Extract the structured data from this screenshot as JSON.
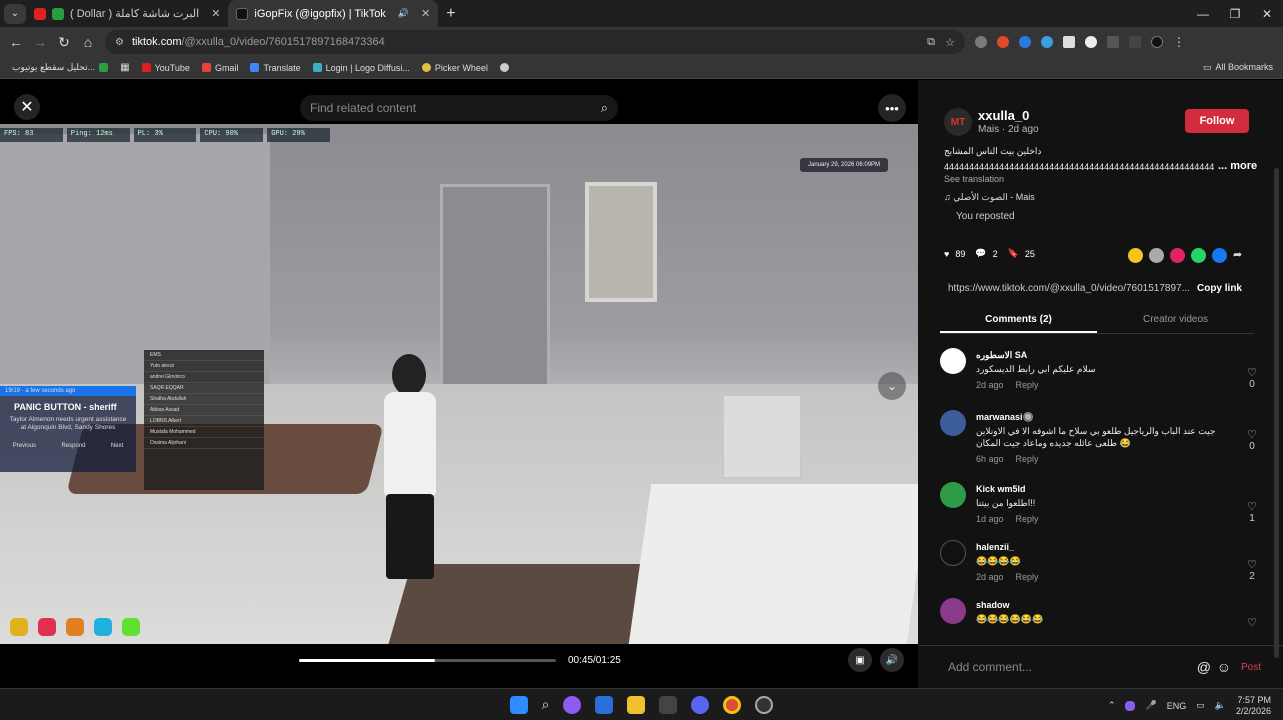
{
  "browser": {
    "tabs": [
      {
        "label": "( Dollar ) البرت شاشة كاملة",
        "active": false,
        "icon": "youtube-icon"
      },
      {
        "label": "iGopFix (@igopfix) | TikTok",
        "active": true,
        "icon": "tiktok-icon"
      }
    ],
    "url_host": "tiktok.com",
    "url_path": "/@xxulla_0/video/7601517897168473364",
    "bookmarks": [
      "تحليل سقطع يوتيوب...",
      "YouTube",
      "Gmail",
      "Translate",
      "Login | Logo Diffusi...",
      "Picker Wheel"
    ],
    "all_bookmarks": "All Bookmarks"
  },
  "video": {
    "search_placeholder": "Find related content",
    "time": "00:45/01:25",
    "progress_fraction": 0.53,
    "hud": [
      "FPS: 83",
      "Ping: 12ms",
      "PL: 3%",
      "CPU: 90%",
      "GPU: 29%"
    ],
    "timestamp": "January 29, 2026 06:09PM",
    "panic": {
      "head": "19/19 · a few seconds ago",
      "title": "PANIC BUTTON - sheriff",
      "body": "Taylor Almenon needs urgent assistance at Algonquin Blvd, Sandy Shores",
      "actions": [
        "Previous",
        "Respond",
        "Next"
      ]
    },
    "ems_rows": [
      "EMS",
      "Yuto alerut",
      "andrei Glovinco",
      "SAQR EQQAR",
      "Shatha Abdullah",
      "Abbas Assad",
      "LOBNS Albert",
      "Mustafa Mohammed",
      "Ossima Aljohani"
    ]
  },
  "creator": {
    "avatar": "MT",
    "username": "xxulla_0",
    "meta": "Mais · 2d ago",
    "follow": "Follow",
    "caption_line1": "داخلين بيت الناس المشابج",
    "caption_line2": "4444444444444444444444444444444444444444444444444444444444",
    "more": "... more",
    "see_translation": "See translation",
    "music": "الصوت الأصلي - Mais",
    "reposted": "You reposted"
  },
  "stats": {
    "likes": "89",
    "comments": "2",
    "saves": "25"
  },
  "link": {
    "url": "https://www.tiktok.com/@xxulla_0/video/7601517897...",
    "copy": "Copy link"
  },
  "panel_tabs": {
    "comments": "Comments (2)",
    "creator": "Creator videos"
  },
  "comments": [
    {
      "name": "الاسطوره SA",
      "text": "سلام عليكم ابي رابط الديسكورد",
      "age": "2d ago",
      "reply": "Reply",
      "likes": "0",
      "color": "#ffffff"
    },
    {
      "name": "marwanasi🔘",
      "text": "جيت عند الباب والرياجيل طلعو بي سلاح ما اشوفه الا في الاونلاين طلعى عائله جديده وماعاد جيت المكان 😂",
      "age": "6h ago",
      "reply": "Reply",
      "likes": "0",
      "color": "#3b5e9a"
    },
    {
      "name": "Kick wm5ld",
      "text": "اطلعوا من بيتنا!!",
      "age": "1d ago",
      "reply": "Reply",
      "likes": "1",
      "color": "#2e9b47"
    },
    {
      "name": "halenzii_",
      "text": "😂😂😂😂",
      "age": "2d ago",
      "reply": "Reply",
      "likes": "2",
      "color": "#111111"
    },
    {
      "name": "shadow",
      "text": "😂😂😂😂😂😂",
      "age": "",
      "reply": "",
      "likes": "",
      "color": "#8a3a8a"
    }
  ],
  "composer": {
    "placeholder": "Add comment...",
    "post": "Post"
  },
  "taskbar": {
    "lang": "ENG",
    "time": "7:57 PM",
    "date": "2/2/2026"
  }
}
